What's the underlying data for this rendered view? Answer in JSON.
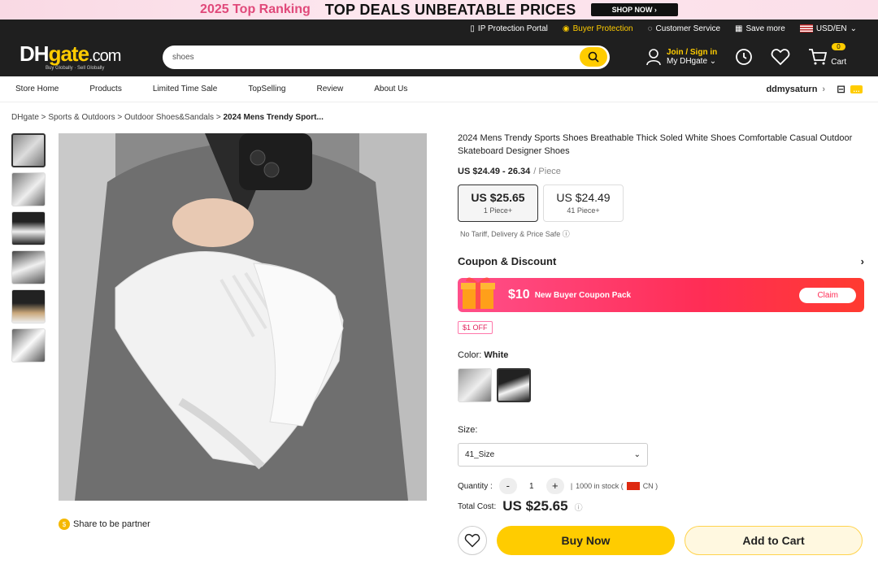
{
  "banner": {
    "ranking": "2025 Top Ranking",
    "deals": "TOP DEALS  UNBEATABLE PRICES",
    "shop_now": "SHOP NOW ›"
  },
  "topbar": {
    "ip": "IP Protection Portal",
    "buyer": "Buyer Protection",
    "service": "Customer Service",
    "save": "Save more",
    "currency": "USD/EN"
  },
  "header": {
    "logo_main": "DH",
    "logo_gate": "gate",
    "logo_com": ".com",
    "logo_tag": "Buy Globally · Sell Globally",
    "search_value": "shoes",
    "join": "Join / Sign in",
    "my": "My DHgate",
    "cart_count": "0",
    "cart_label": "Cart"
  },
  "nav": {
    "links": [
      "Store Home",
      "Products",
      "Limited Time Sale",
      "TopSelling",
      "Review",
      "About Us"
    ],
    "store": "ddmysaturn"
  },
  "breadcrumb": {
    "items": [
      "DHgate",
      "Sports & Outdoors",
      "Outdoor Shoes&Sandals"
    ],
    "current": "2024 Mens Trendy Sport..."
  },
  "share": "Share to be partner",
  "product": {
    "title": "2024 Mens Trendy Sports Shoes Breathable Thick Soled White Shoes Comfortable Casual Outdoor Skateboard Designer Shoes",
    "price_range": "US $24.49 - 26.34",
    "per": "/ Piece",
    "tiers": [
      {
        "price": "US $25.65",
        "qty": "1 Piece+"
      },
      {
        "price": "US $24.49",
        "qty": "41 Piece+"
      }
    ],
    "safe": "No Tariff, Delivery & Price Safe",
    "coupon_title": "Coupon & Discount",
    "coupon_amount": "$10",
    "coupon_text": "New Buyer Coupon Pack",
    "claim": "Claim",
    "off": "$1 OFF",
    "color_label": "Color:",
    "color_value": "White",
    "size_label": "Size:",
    "size_value": "41_Size",
    "qty_label": "Quantity :",
    "qty_value": "1",
    "stock": "1000 in stock (",
    "origin": "CN )",
    "total_label": "Total Cost:",
    "total_value": "US $25.65",
    "buy_now": "Buy Now",
    "add_cart": "Add to Cart"
  }
}
